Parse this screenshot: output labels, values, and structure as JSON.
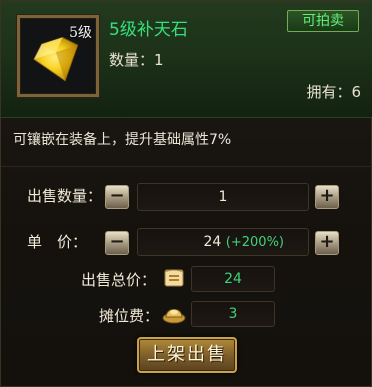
{
  "item": {
    "level_badge": "5级",
    "name": "5级补天石",
    "quantity_text": "数量：1",
    "owned_text": "拥有：6",
    "description": "可镶嵌在装备上，提升基础属性7%",
    "icon": "yellow-gem-icon"
  },
  "header": {
    "sellable_label": "可拍卖"
  },
  "form": {
    "qty_label": "出售数量：",
    "qty_value": "1",
    "price_label": "单　价：",
    "price_value": "24",
    "price_bonus": "(+200%)",
    "total_label": "出售总价：",
    "total_value": "24",
    "fee_label": "摊位费：",
    "fee_value": "3",
    "minus_symbol": "−",
    "plus_symbol": "+"
  },
  "actions": {
    "list_button": "上架出售"
  },
  "colors": {
    "accent_green": "#40d27a",
    "gold": "#caa24c"
  }
}
